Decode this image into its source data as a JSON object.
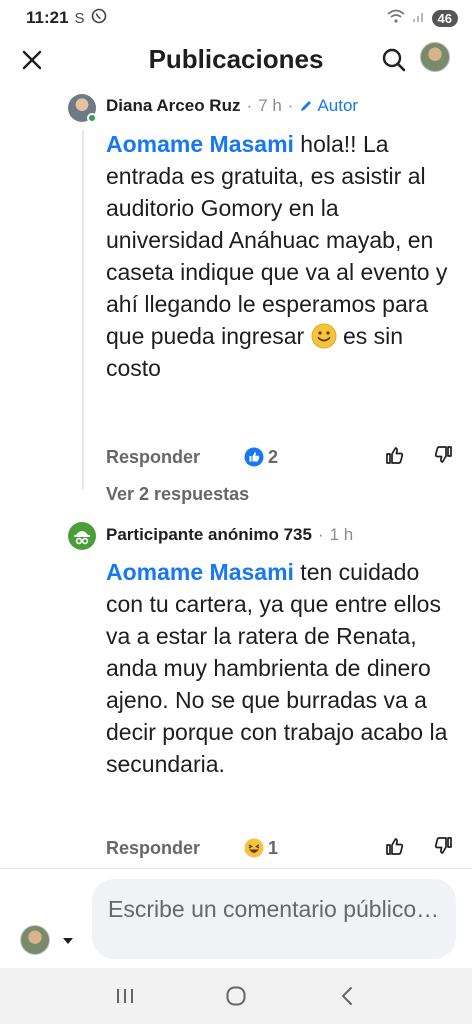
{
  "status_bar": {
    "time": "11:21",
    "left_icons": [
      "S",
      "phone-icon"
    ],
    "battery": "46"
  },
  "header": {
    "title": "Publicaciones",
    "close_icon": "close-icon",
    "search_icon": "search-icon"
  },
  "comments": [
    {
      "author": "Diana Arceo Ruz",
      "time": "7 h",
      "badge": "Autor",
      "mention": "Aomame Masami",
      "text": " hola!! La entrada es gratuita, es asistir al auditorio Gomory en la universidad Anáhuac mayab, en caseta indique que va al evento y ahí llegando le esperamos para que pueda ingresar ",
      "text_after_emoji": " es sin costo",
      "reply_label": "Responder",
      "reaction": "like",
      "reaction_count": "2",
      "view_replies": "Ver 2 respuestas"
    },
    {
      "author": "Participante anónimo 735",
      "time": "1 h",
      "mention": "Aomame Masami",
      "text": " ten cuidado con tu cartera, ya que entre ellos va a estar la ratera de Renata, anda muy hambrienta de dinero ajeno. No se que burradas va a decir porque con trabajo acabo la secundaria.",
      "reply_label": "Responder",
      "reaction": "haha",
      "reaction_count": "1"
    }
  ],
  "composer": {
    "placeholder": "Escribe un comentario público…"
  },
  "colors": {
    "accent": "#1877f2",
    "secondary_text": "#65676b",
    "anon_green": "#4a9e3a"
  }
}
